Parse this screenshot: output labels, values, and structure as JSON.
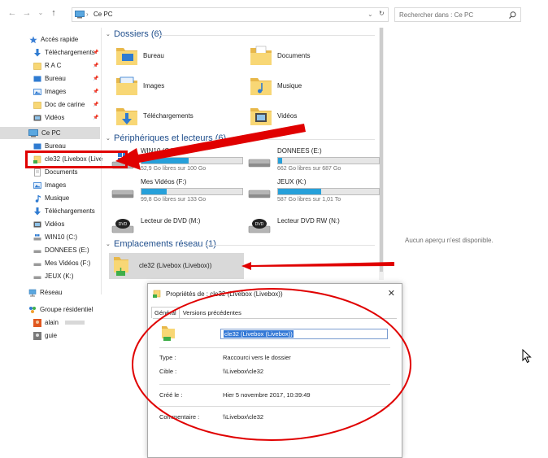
{
  "address": {
    "path_root": "Ce PC",
    "separator": "›"
  },
  "search": {
    "placeholder": "Rechercher dans : Ce PC"
  },
  "sidebar": {
    "items": [
      {
        "label": "Accès rapide"
      },
      {
        "label": "Téléchargements"
      },
      {
        "label": "R A C"
      },
      {
        "label": "Bureau"
      },
      {
        "label": "Images"
      },
      {
        "label": "Doc de carine"
      },
      {
        "label": "Vidéos"
      },
      {
        "label": "Ce PC"
      },
      {
        "label": "Bureau"
      },
      {
        "label": "cle32 (Livebox (Live"
      },
      {
        "label": "Documents"
      },
      {
        "label": "Images"
      },
      {
        "label": "Musique"
      },
      {
        "label": "Téléchargements"
      },
      {
        "label": "Vidéos"
      },
      {
        "label": "WIN10 (C:)"
      },
      {
        "label": "DONNEES (E:)"
      },
      {
        "label": "Mes Vidéos (F:)"
      },
      {
        "label": "JEUX (K:)"
      },
      {
        "label": "Réseau"
      },
      {
        "label": "Groupe résidentiel"
      },
      {
        "label": "alain"
      },
      {
        "label": "guie"
      }
    ]
  },
  "sections": {
    "folders": "Dossiers (6)",
    "devices": "Périphériques et lecteurs (6)",
    "network": "Emplacements réseau (1)"
  },
  "folders": [
    {
      "name": "Bureau"
    },
    {
      "name": "Documents"
    },
    {
      "name": "Images"
    },
    {
      "name": "Musique"
    },
    {
      "name": "Téléchargements"
    },
    {
      "name": "Vidéos"
    }
  ],
  "drives": [
    {
      "name": "WIN10 (C:)",
      "free": "52,9 Go libres sur 100 Go",
      "used_fraction": 0.47
    },
    {
      "name": "DONNEES (E:)",
      "free": "662 Go libres sur 687 Go",
      "used_fraction": 0.04
    },
    {
      "name": "Mes Vidéos (F:)",
      "free": "99,8 Go libres sur 133 Go",
      "used_fraction": 0.25
    },
    {
      "name": "JEUX (K:)",
      "free": "587 Go libres sur 1,01 To",
      "used_fraction": 0.43
    }
  ],
  "dvd": [
    {
      "name": "Lecteur de DVD (M:)"
    },
    {
      "name": "Lecteur DVD RW (N:)"
    }
  ],
  "network_item": {
    "name": "cle32 (Livebox (Livebox))"
  },
  "preview": {
    "text": "Aucun aperçu n'est disponible."
  },
  "dialog": {
    "title": "Propriétés de : cle32 (Livebox (Livebox))",
    "close": "✕",
    "tabs": [
      "Général",
      "Versions précédentes"
    ],
    "name_value": "cle32 (Livebox (Livebox))",
    "type_label": "Type :",
    "type_value": "Raccourci vers le dossier",
    "target_label": "Cible :",
    "target_value": "\\\\Livebox\\cle32",
    "created_label": "Créé le :",
    "created_value": "Hier 5 novembre 2017, 10:39:49",
    "comment_label": "Commentaire :",
    "comment_value": "\\\\Livebox\\cle32"
  },
  "colors": {
    "accent": "#26a0da",
    "annotation": "#e00000",
    "section_header": "#1f4e8c"
  }
}
